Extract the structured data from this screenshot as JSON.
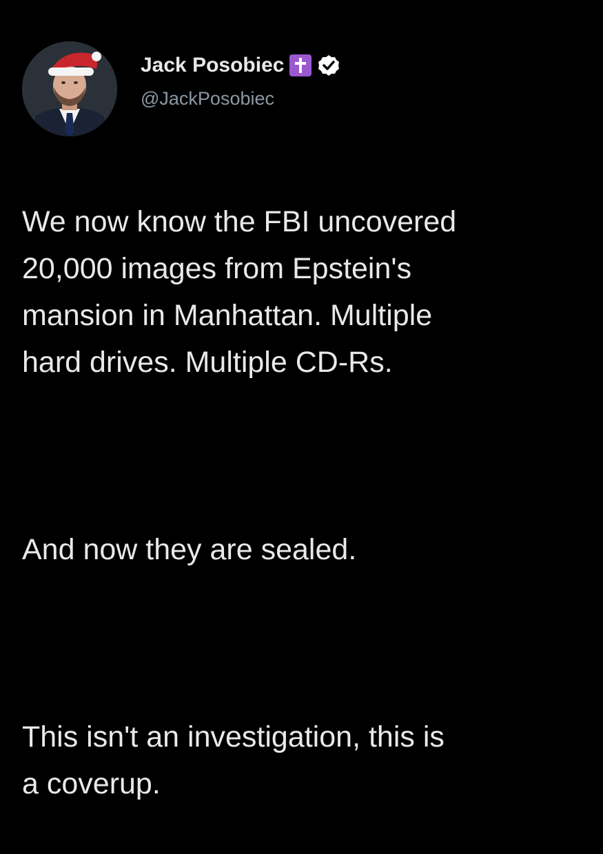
{
  "author": {
    "display_name": "Jack Posobiec",
    "handle": "@JackPosobiec",
    "avatar_icon": "avatar-portrait-santa-hat",
    "badges": [
      "cross-badge-icon",
      "verified-badge-icon"
    ]
  },
  "colors": {
    "background": "#000000",
    "text": "#e7e9ea",
    "handle": "#8b98a5",
    "cross_badge": "#9b59d0",
    "verified_badge": "#ffffff"
  },
  "tweet": {
    "paragraphs": [
      "We now know the FBI uncovered\n20,000 images from Epstein's\nmansion in Manhattan. Multiple\nhard drives. Multiple CD-Rs.",
      "And now they are sealed.",
      "This isn't an investigation, this is\na coverup."
    ]
  }
}
